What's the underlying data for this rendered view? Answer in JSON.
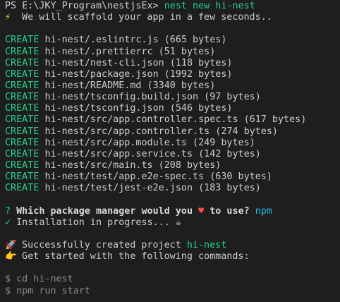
{
  "terminal": {
    "prompt": "PS E:\\JKY_Program\\nestjsEx>",
    "command": "nest new hi-nest",
    "scaffold_message": " We will scaffold your app in a few seconds..",
    "create_label": "CREATE",
    "files": [
      "hi-nest/.eslintrc.js (665 bytes)",
      "hi-nest/.prettierrc (51 bytes)",
      "hi-nest/nest-cli.json (118 bytes)",
      "hi-nest/package.json (1992 bytes)",
      "hi-nest/README.md (3340 bytes)",
      "hi-nest/tsconfig.build.json (97 bytes)",
      "hi-nest/tsconfig.json (546 bytes)",
      "hi-nest/src/app.controller.spec.ts (617 bytes)",
      "hi-nest/src/app.controller.ts (274 bytes)",
      "hi-nest/src/app.module.ts (249 bytes)",
      "hi-nest/src/app.service.ts (142 bytes)",
      "hi-nest/src/main.ts (208 bytes)",
      "hi-nest/test/app.e2e-spec.ts (630 bytes)",
      "hi-nest/test/jest-e2e.json (183 bytes)"
    ],
    "question_mark": "?",
    "question_part1": "Which package manager would you",
    "question_part2": "to use?",
    "package_manager": "npm",
    "check_mark": "✓",
    "install_text": "Installation in progress...",
    "success_text": " Successfully created project",
    "project_name": "hi-nest",
    "get_started_text": " Get started with the following commands:",
    "next_steps": [
      "$ cd hi-nest",
      "$ npm run start"
    ]
  },
  "icons": {
    "bolt": "bolt-icon",
    "heart": "heart-icon",
    "coffee": "coffee-icon",
    "rocket": "rocket-icon",
    "pointing_hand": "pointing-hand-icon"
  },
  "colors": {
    "background": "#1e1e1e",
    "text": "#cccccc",
    "create_green": "#23d18b",
    "accent_cyan": "#29b8db",
    "muted_gray": "#8a8a8a",
    "heart_red": "#ff4a4a"
  }
}
